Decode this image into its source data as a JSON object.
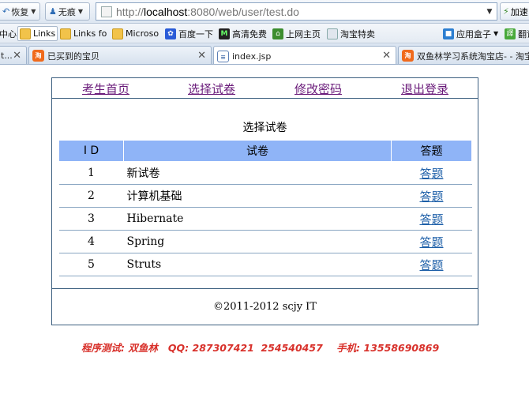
{
  "browser": {
    "toolbar": {
      "restore_label": "恢复",
      "incognito_label": "无痕",
      "accelerate_label": "加速"
    },
    "address_bar": {
      "url_prefix": "http://",
      "url_host": "localhost",
      "url_rest": ":8080/web/user/test.do"
    },
    "favorites": [
      {
        "label": "中心",
        "icon": "none"
      },
      {
        "label": "Links",
        "icon": "folder-icon"
      },
      {
        "label": "Links fo",
        "icon": "folder-icon"
      },
      {
        "label": "Microso",
        "icon": "folder-icon"
      },
      {
        "label": "百度一下",
        "icon": "paw-icon"
      },
      {
        "label": "高清免费",
        "icon": "m-icon"
      },
      {
        "label": "上网主页",
        "icon": "home-icon"
      },
      {
        "label": "淘宝特卖",
        "icon": "taobao-icon"
      },
      {
        "label": "应用盒子",
        "icon": "box-icon"
      },
      {
        "label": "翻译",
        "icon": "translate-icon"
      }
    ],
    "tabs": [
      {
        "label": "t...",
        "icon": "tab-partial"
      },
      {
        "label": "已买到的宝贝",
        "icon": "taobao-tab-icon"
      },
      {
        "label": "index.jsp",
        "icon": "document-icon",
        "active": true
      },
      {
        "label": "双鱼林学习系统淘宝店- - 淘宝",
        "icon": "taobao-tab-icon"
      }
    ]
  },
  "page": {
    "nav": [
      {
        "label": "考生首页"
      },
      {
        "label": "选择试卷"
      },
      {
        "label": "修改密码"
      },
      {
        "label": "退出登录"
      }
    ],
    "section_title": "选择试卷",
    "table": {
      "headers": [
        "I D",
        "试卷",
        "答题"
      ],
      "rows": [
        {
          "id": "1",
          "name": "新试卷",
          "action": "答题"
        },
        {
          "id": "2",
          "name": "计算机基础",
          "action": "答题"
        },
        {
          "id": "3",
          "name": "Hibernate",
          "action": "答题"
        },
        {
          "id": "4",
          "name": "Spring",
          "action": "答题"
        },
        {
          "id": "5",
          "name": "Struts",
          "action": "答题"
        }
      ]
    },
    "footer": "©2011-2012 scjy IT",
    "tester_line": "程序测试: 双鱼林   QQ: 287307421  254540457    手机: 13558690869"
  },
  "colors": {
    "table_header_bg": "#8fb4f7",
    "nav_link": "#6a1b7a",
    "answer_link": "#1d5fa8",
    "tester_text": "#d8312b",
    "border": "#3d6080"
  }
}
